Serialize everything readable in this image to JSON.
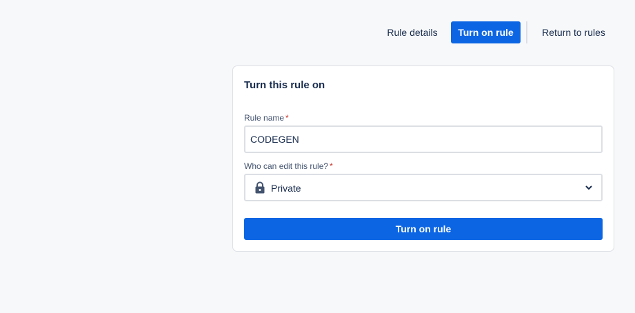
{
  "nav": {
    "rule_details": "Rule details",
    "turn_on_rule": "Turn on rule",
    "return_to_rules": "Return to rules"
  },
  "card": {
    "title": "Turn this rule on",
    "rule_name_label": "Rule name",
    "rule_name_value": "CODEGEN",
    "edit_label": "Who can edit this rule?",
    "required_marker": "*",
    "edit_value": "Private",
    "edit_icon": "lock-icon",
    "submit_label": "Turn on rule"
  },
  "colors": {
    "primary": "#0c66e4",
    "required": "#c9372c",
    "background": "#f7f8f9"
  }
}
